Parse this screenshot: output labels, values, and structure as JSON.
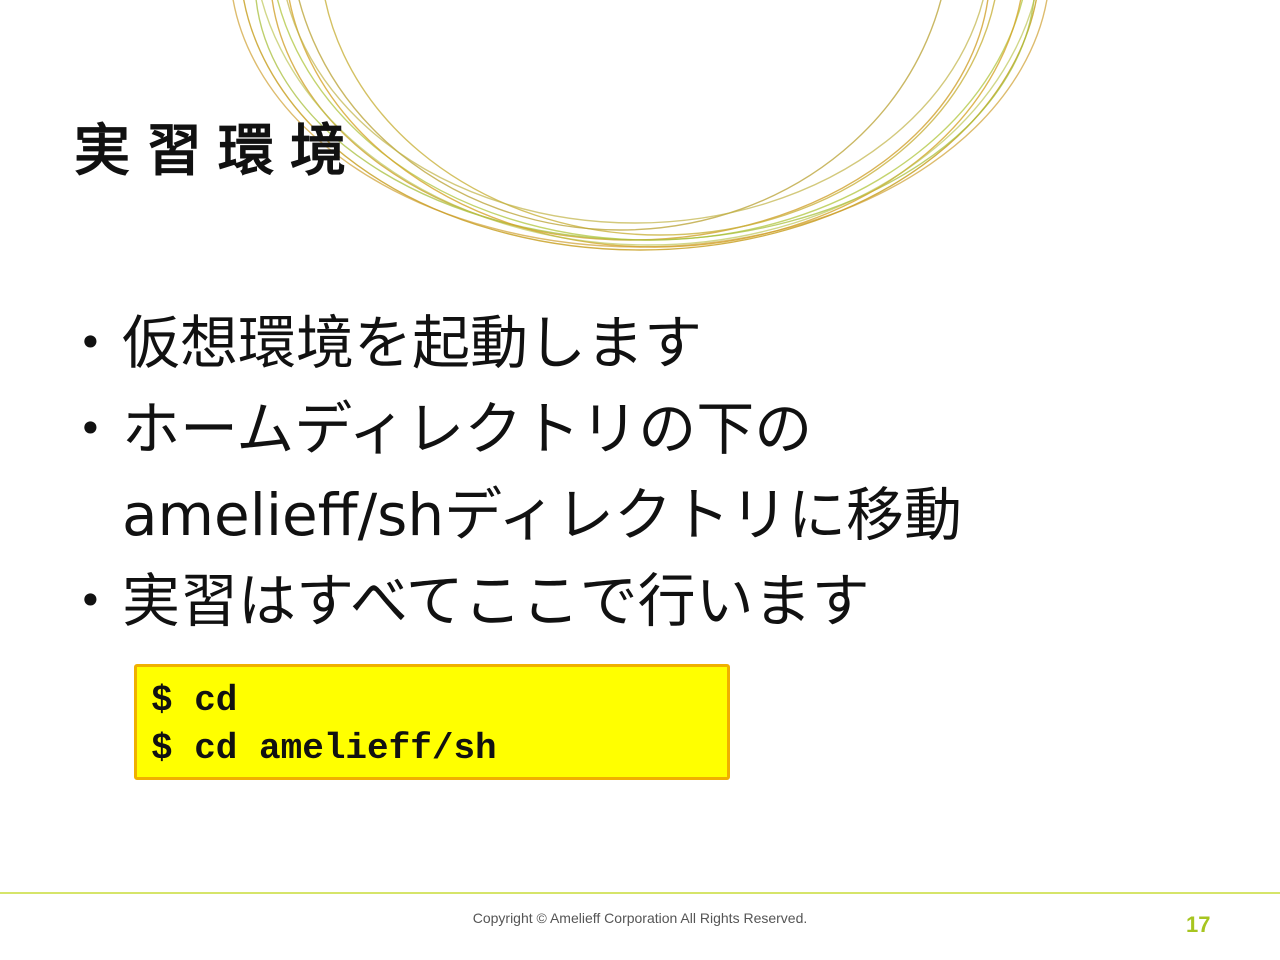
{
  "slide": {
    "title": "実習環境",
    "bullets": [
      "仮想環境を起動します",
      "ホームディレクトリの下の amelieff/shディレクトリに移動",
      "実習はすべてここで行います"
    ],
    "bullet_marker": "•",
    "code_lines": [
      "$ cd",
      "$ cd amelieff/sh"
    ]
  },
  "footer": {
    "copyright": "Copyright © Amelieff Corporation All Rights Reserved.",
    "page_number": "17"
  },
  "colors": {
    "code_background": "#ffff00",
    "code_border": "#f0b000",
    "footer_rule": "#d6e56a",
    "page_number": "#a7c520",
    "decoration_gold": "#c9a227",
    "decoration_green": "#b5c94a"
  }
}
